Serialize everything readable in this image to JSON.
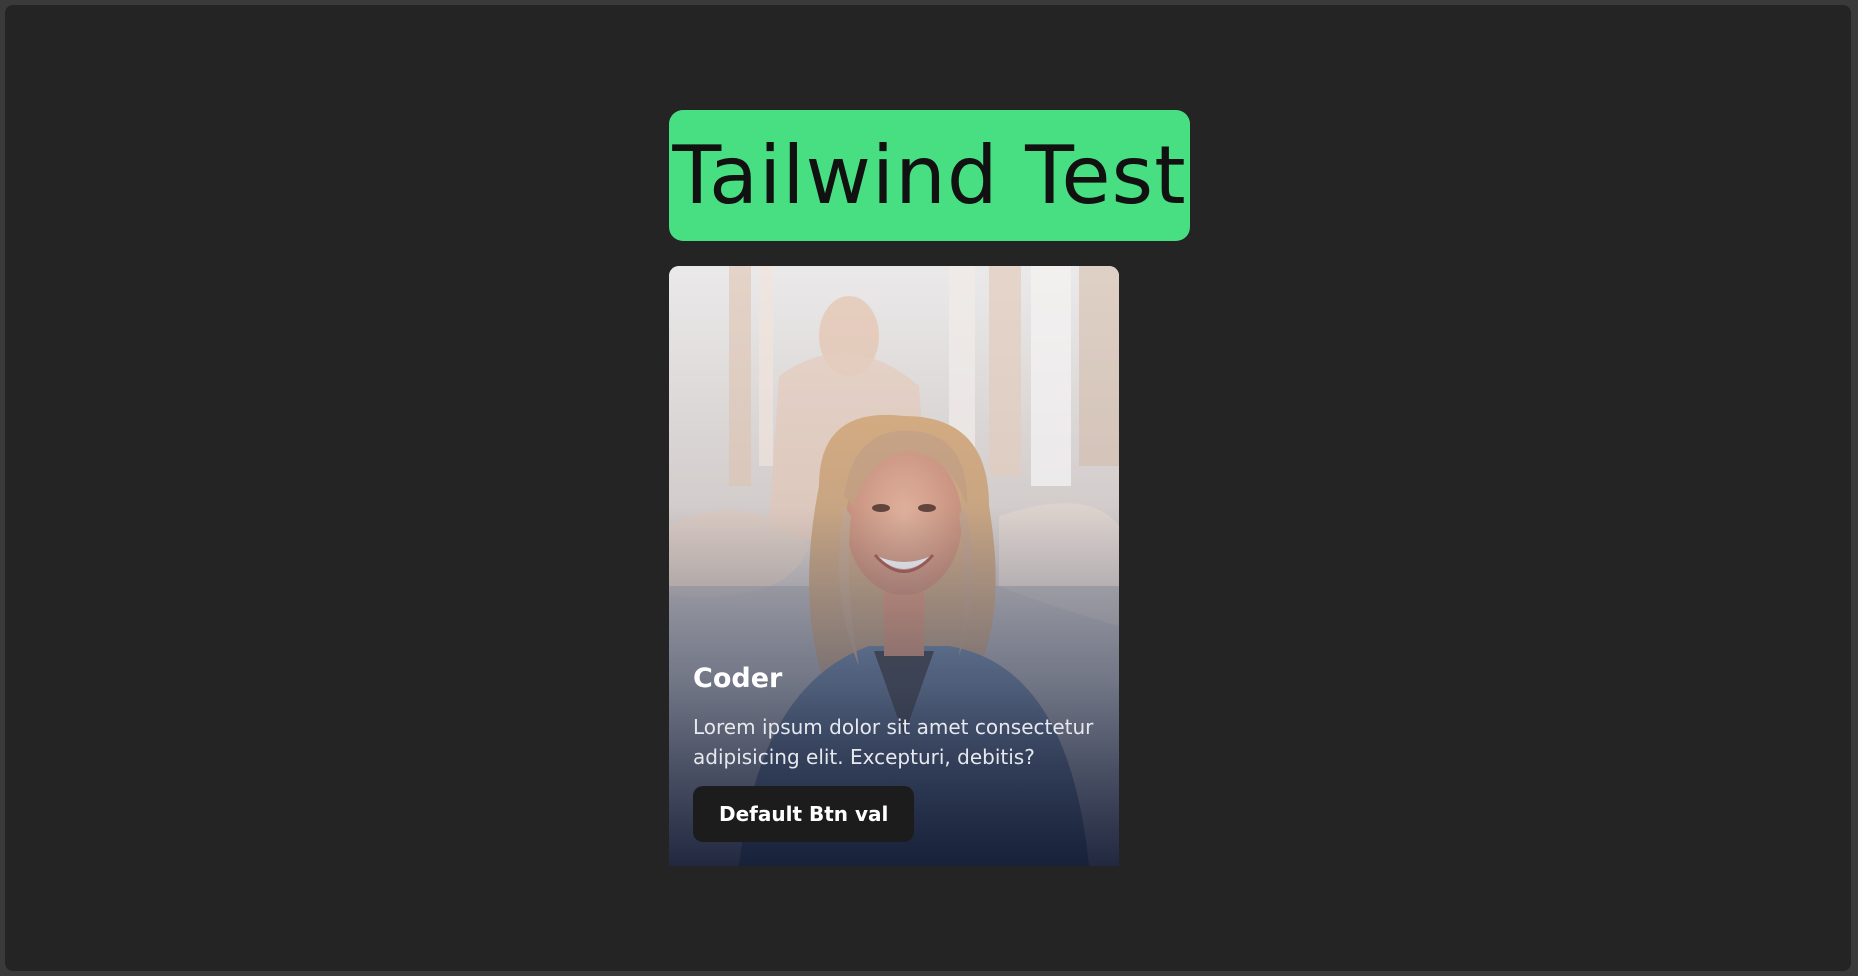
{
  "header": {
    "title": "Tailwind Test",
    "badge_color": "#48df83"
  },
  "card": {
    "image_alt": "Smiling woman with wavy blonde hair wearing a denim jacket in front of a stone fountain",
    "title": "Coder",
    "description": "Lorem ipsum dolor sit amet consectetur adipisicing elit. Excepturi, debitis?",
    "button_label": "Default Btn val"
  },
  "colors": {
    "page_background": "#242424",
    "card_gradient_bottom": "#161e37",
    "button_background": "#1c1c1c"
  }
}
